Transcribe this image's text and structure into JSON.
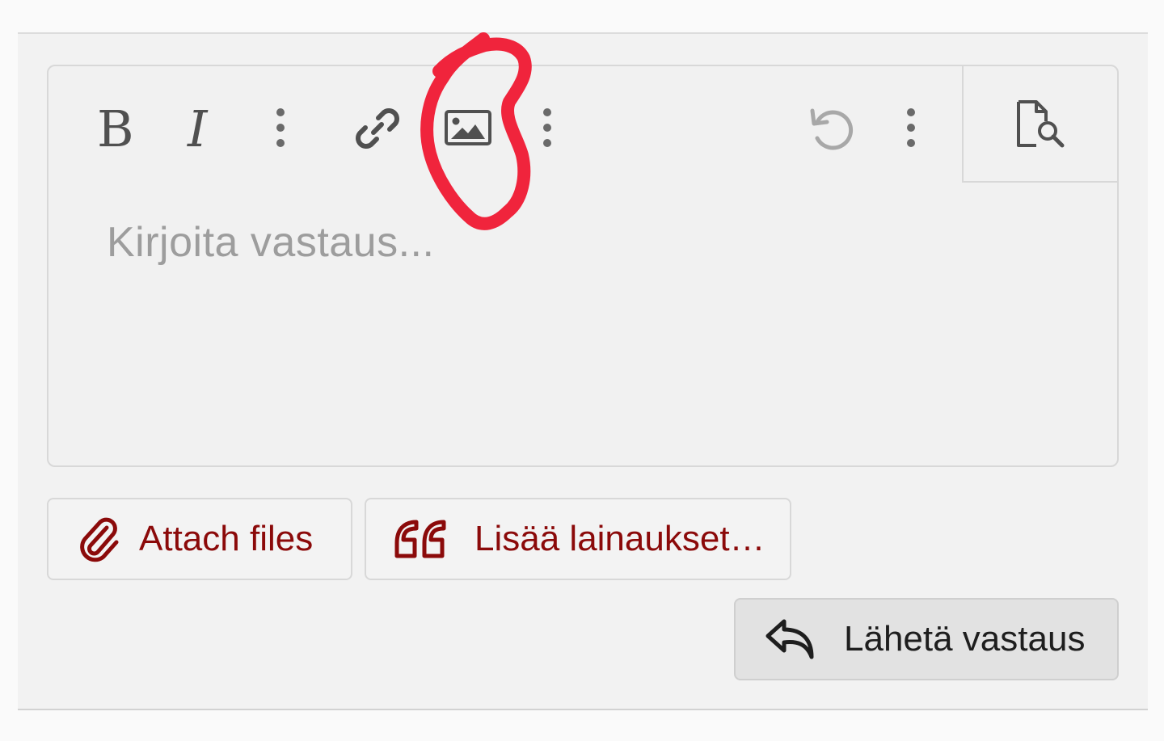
{
  "editor": {
    "placeholder": "Kirjoita vastaus...",
    "toolbar": [
      {
        "name": "bold",
        "icon": "bold-icon"
      },
      {
        "name": "italic",
        "icon": "italic-icon"
      },
      {
        "name": "more-text",
        "icon": "more-vertical-icon"
      },
      {
        "name": "link",
        "icon": "link-icon"
      },
      {
        "name": "image",
        "icon": "image-icon"
      },
      {
        "name": "more-insert",
        "icon": "more-vertical-icon"
      },
      {
        "name": "undo",
        "icon": "undo-icon"
      },
      {
        "name": "more-options",
        "icon": "more-vertical-icon"
      },
      {
        "name": "preview",
        "icon": "document-search-icon"
      }
    ]
  },
  "actions": {
    "attach_label": "Attach files",
    "attach_icon": "paperclip-icon",
    "quotes_label": "Lisää lainaukset…",
    "quotes_icon": "quote-icon",
    "submit_label": "Lähetä vastaus",
    "submit_icon": "reply-icon"
  },
  "colors": {
    "accent": "#8b0a0a",
    "icon": "#505050",
    "icon_disabled": "#a8a8a8",
    "annotation": "#f0243c",
    "panel_bg": "#f2f2f2"
  }
}
